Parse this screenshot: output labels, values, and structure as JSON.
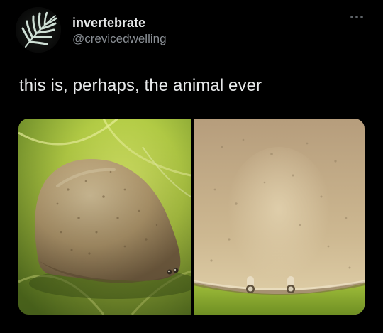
{
  "tweet": {
    "author": {
      "display_name": "invertebrate",
      "handle": "@crevicedwelling",
      "avatar_icon": "fern-leaf-icon"
    },
    "more_icon": "more-dots-icon",
    "text": "this is, perhaps, the animal ever",
    "media": {
      "photos": [
        {
          "subject": "slug-on-leaf-side-view"
        },
        {
          "subject": "slug-closeup-front-view"
        }
      ]
    }
  },
  "colors": {
    "background": "#000000",
    "text_primary": "#e7e9ea",
    "text_secondary": "#8b9096"
  }
}
